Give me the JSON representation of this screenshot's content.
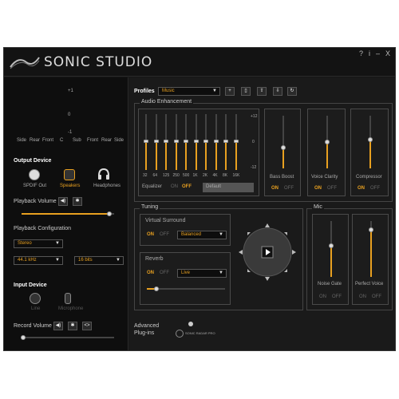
{
  "app": {
    "title": "SONIC STUDIO",
    "controls": [
      "?",
      "i",
      "–",
      "X"
    ]
  },
  "left": {
    "channels": {
      "top": "+1",
      "mid": "0",
      "bottom": "-1",
      "labels": [
        "Side",
        "Rear",
        "Front",
        "C",
        "Sub",
        "Front",
        "Rear",
        "Side"
      ]
    },
    "output_device": {
      "title": "Output Device",
      "devices": [
        "SPDIF Out",
        "Speakers",
        "Headphones"
      ],
      "selected": "Speakers"
    },
    "playback_volume": {
      "label": "Playback Volume",
      "level_percent": 95
    },
    "playback_configuration": {
      "label": "Playback Configuration",
      "channel": "Stereo",
      "rate": "44.1 kHz",
      "bits": "16 bits"
    },
    "input_device": {
      "title": "Input Device",
      "devices": [
        "Line",
        "Microphone"
      ]
    },
    "record_volume": {
      "label": "Record Volume",
      "level_percent": 2
    }
  },
  "profiles": {
    "label": "Profiles",
    "value": "Music"
  },
  "audio_enhancement": {
    "title": "Audio Enhancement",
    "eq_bands": [
      "32",
      "64",
      "125",
      "250",
      "500",
      "1K",
      "2K",
      "4K",
      "8K",
      "16K"
    ],
    "eq_scale": [
      "+12",
      "0",
      "-12"
    ],
    "equalizer_label": "Equalizer",
    "on": "ON",
    "off": "OFF",
    "equalizer_state": "OFF",
    "preset": "Default",
    "bass_boost": {
      "label": "Bass Boost",
      "state": "ON",
      "level": 0.4
    },
    "voice_clarity": {
      "label": "Voice Clarity",
      "state": "ON",
      "level": 0.5
    },
    "compressor": {
      "label": "Compressor",
      "state": "ON",
      "level": 0.55
    }
  },
  "tuning": {
    "title": "Tuning",
    "virtual_surround": {
      "label": "Virtual Surround",
      "state": "ON",
      "mode": "Balanced"
    },
    "reverb": {
      "label": "Reverb",
      "state": "ON",
      "mode": "Live",
      "level": 0.12
    }
  },
  "mic": {
    "title": "Mic",
    "noise_gate": {
      "label": "Noise Gate",
      "on": "ON",
      "off": "OFF",
      "level": 0.55
    },
    "perfect_voice": {
      "label": "Perfect Voice",
      "on": "ON",
      "off": "OFF",
      "level": 0.85
    }
  },
  "advanced": {
    "label_line1": "Advanced",
    "label_line2": "Plug-ins",
    "plugin": "SONIC RADAR PRO"
  },
  "colors": {
    "accent": "#e8a020",
    "background": "#161616"
  }
}
